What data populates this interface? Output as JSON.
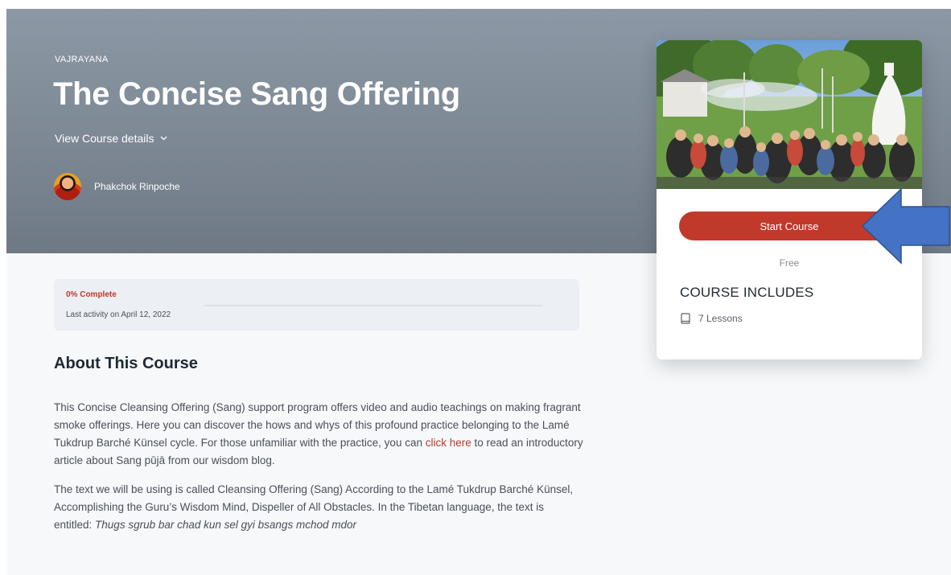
{
  "hero": {
    "category": "VAJRAYANA",
    "title": "The Concise Sang Offering",
    "details_toggle": "View Course details",
    "author": "Phakchok Rinpoche"
  },
  "progress": {
    "percent_label": "0% Complete",
    "percent_value": 0,
    "last_activity": "Last activity on April 12, 2022"
  },
  "about": {
    "heading": "About This Course",
    "p1_before": "This Concise Cleansing Offering (Sang) support program offers video and audio teachings on making fragrant smoke offerings. Here you can discover the hows and whys of this profound practice belonging to the Lamé Tukdrup Barché Künsel cycle. For those unfamiliar with the practice, you can ",
    "p1_link": "click here",
    "p1_after": " to read an introductory article about Sang pūjā from our wisdom blog.",
    "p2_before": "The text we will be using is called Cleansing Offering (Sang) According to the Lamé Tukdrup Barché Künsel, Accomplishing the Guru’s Wisdom Mind, Dispeller of All Obstacles. In the Tibetan language, the text is entitled: ",
    "p2_italic": "Thugs sgrub bar chad kun sel gyi bsangs mchod mdor"
  },
  "sidebar": {
    "start_button": "Start Course",
    "price": "Free",
    "includes_title": "COURSE INCLUDES",
    "lessons": "7 Lessons"
  },
  "colors": {
    "accent": "#c0392b",
    "hero_bg": "#7d8894",
    "arrow": "#4472c4"
  },
  "icons": {
    "details": "chevron-down-icon",
    "lessons": "book-icon",
    "pointer": "arrow-left-icon"
  }
}
